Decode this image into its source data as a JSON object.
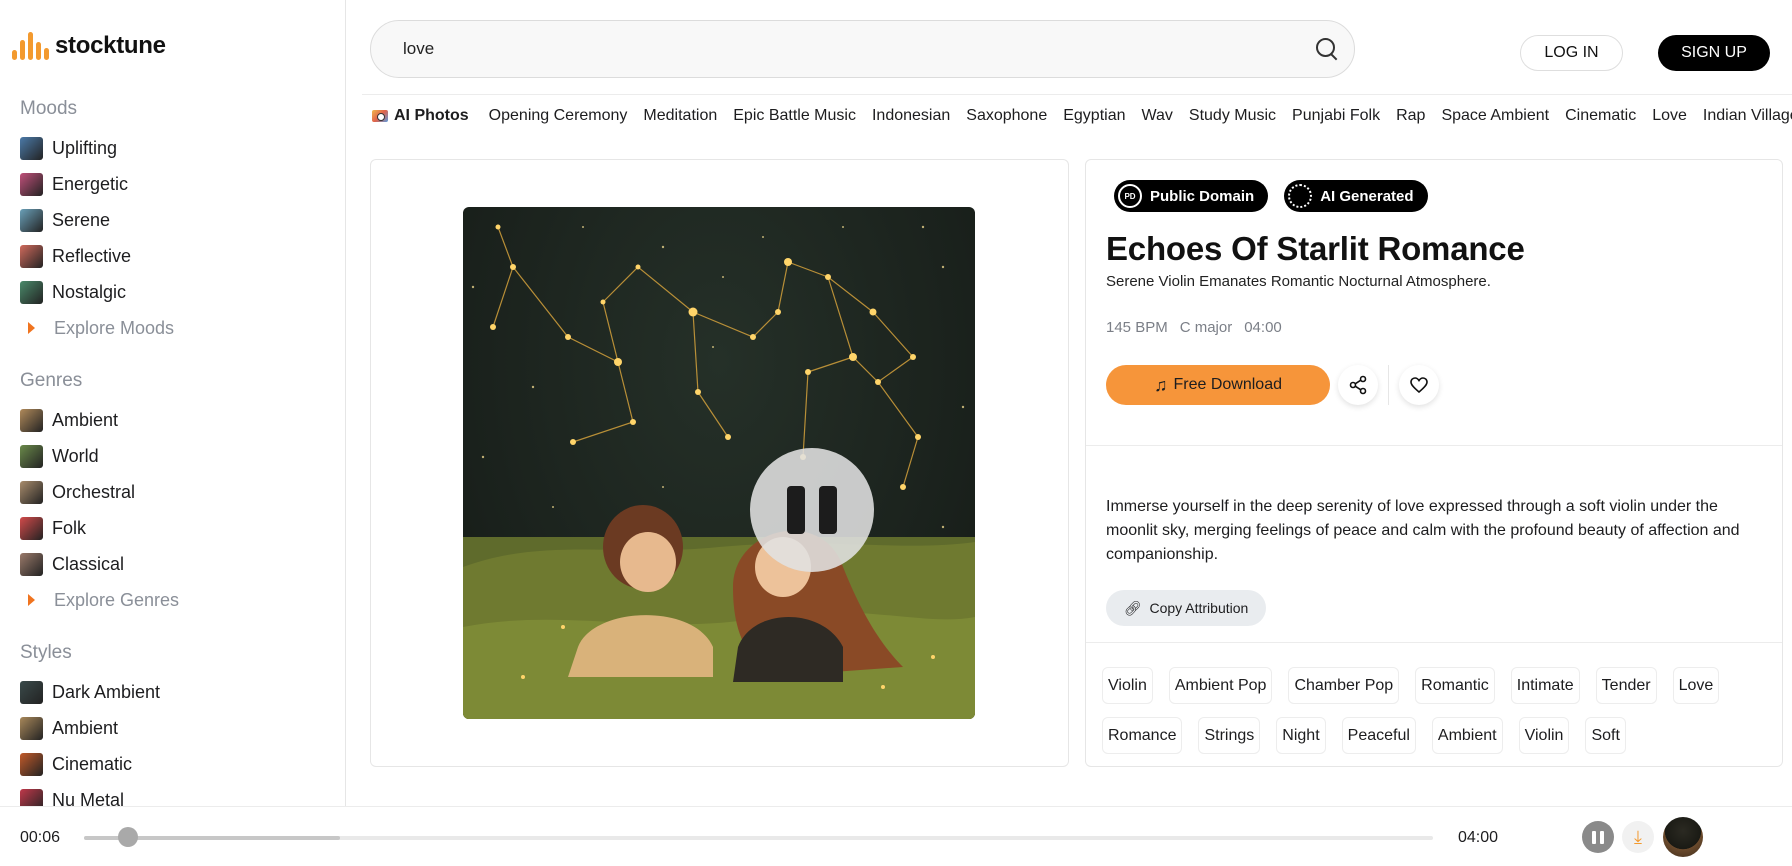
{
  "brand": {
    "name": "stocktune",
    "accent": "#f39a2f"
  },
  "search": {
    "value": "love",
    "placeholder": ""
  },
  "auth": {
    "login": "LOG IN",
    "signup": "SIGN UP"
  },
  "tags_bar": {
    "ai_photos": "AI Photos",
    "items": [
      "Opening Ceremony",
      "Meditation",
      "Epic Battle Music",
      "Indonesian",
      "Saxophone",
      "Egyptian",
      "Wav",
      "Study Music",
      "Punjabi Folk",
      "Rap",
      "Space Ambient",
      "Cinematic",
      "Love",
      "Indian Village"
    ]
  },
  "sidebar": {
    "moods": {
      "heading": "Moods",
      "items": [
        {
          "label": "Uplifting",
          "color": "#4b7aa8"
        },
        {
          "label": "Energetic",
          "color": "#c0507a"
        },
        {
          "label": "Serene",
          "color": "#6aa0b8"
        },
        {
          "label": "Reflective",
          "color": "#d06a5c"
        },
        {
          "label": "Nostalgic",
          "color": "#4a8a6a"
        }
      ],
      "explore": "Explore Moods"
    },
    "genres": {
      "heading": "Genres",
      "items": [
        {
          "label": "Ambient",
          "color": "#b08a5a"
        },
        {
          "label": "World",
          "color": "#6a8a4a"
        },
        {
          "label": "Orchestral",
          "color": "#a88c6c"
        },
        {
          "label": "Folk",
          "color": "#d24a4a"
        },
        {
          "label": "Classical",
          "color": "#9a7a6a"
        }
      ],
      "explore": "Explore Genres"
    },
    "styles": {
      "heading": "Styles",
      "items": [
        {
          "label": "Dark Ambient",
          "color": "#3a4a4a"
        },
        {
          "label": "Ambient",
          "color": "#a8885a"
        },
        {
          "label": "Cinematic",
          "color": "#c25a2a"
        },
        {
          "label": "Nu Metal",
          "color": "#c0384a"
        }
      ]
    }
  },
  "track": {
    "badges": [
      "Public Domain",
      "AI Generated"
    ],
    "title": "Echoes Of Starlit Romance",
    "subtitle": "Serene Violin Emanates Romantic Nocturnal Atmosphere.",
    "bpm": "145 BPM",
    "key": "C major",
    "duration": "04:00",
    "download_label": "Free Download",
    "description": "Immerse yourself in the deep serenity of love expressed through a soft violin under the moonlit sky, merging feelings of peace and calm with the profound beauty of affection and companionship.",
    "copy_attribution": "Copy Attribution",
    "tags": [
      "Violin",
      "Ambient Pop",
      "Chamber Pop",
      "Romantic",
      "Intimate",
      "Tender",
      "Love",
      "Romance",
      "Strings",
      "Night",
      "Peaceful",
      "Ambient",
      "Violin",
      "Soft"
    ]
  },
  "player": {
    "current": "00:06",
    "total": "04:00",
    "progress": 0.025
  }
}
